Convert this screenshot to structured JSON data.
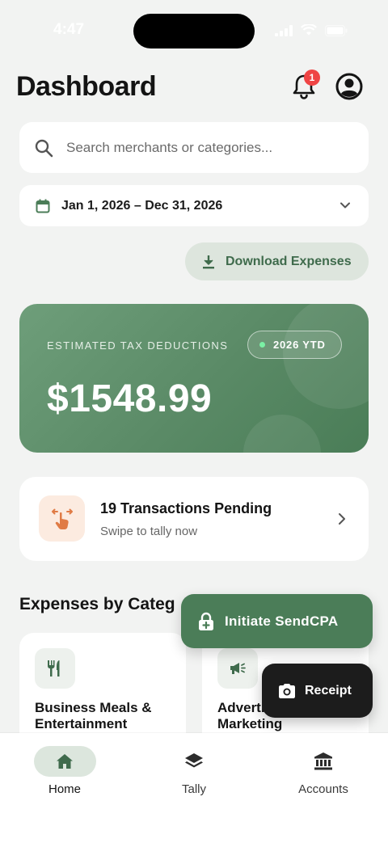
{
  "status_bar": {
    "time": "4:47"
  },
  "header": {
    "title": "Dashboard",
    "notification_count": "1"
  },
  "search": {
    "placeholder": "Search merchants or categories..."
  },
  "date_range": {
    "label": "Jan 1, 2026 – Dec 31, 2026"
  },
  "download": {
    "label": "Download Expenses"
  },
  "tax_card": {
    "label": "ESTIMATED TAX DEDUCTIONS",
    "badge": "2026 YTD",
    "amount": "$1548.99"
  },
  "pending": {
    "title": "19 Transactions Pending",
    "subtitle": "Swipe to tally now"
  },
  "expenses_section": {
    "title": "Expenses by Categ",
    "categories": [
      {
        "name": "Business Meals & Entertainment",
        "icon": "utensils-icon"
      },
      {
        "name": "Advertising & Marketing",
        "icon": "megaphone-icon"
      }
    ]
  },
  "floating": {
    "cpa_label": "Initiate SendCPA",
    "receipt_label": "Receipt"
  },
  "nav": {
    "items": [
      {
        "label": "Home",
        "icon": "home-icon",
        "active": true
      },
      {
        "label": "Tally",
        "icon": "layers-icon",
        "active": false
      },
      {
        "label": "Accounts",
        "icon": "bank-icon",
        "active": false
      }
    ]
  },
  "colors": {
    "accent": "#4b7d58",
    "card_gradient_start": "#6e9e7a",
    "badge_red": "#ef4444",
    "pending_icon_bg": "#fcebe0",
    "pending_icon": "#e07b45"
  }
}
